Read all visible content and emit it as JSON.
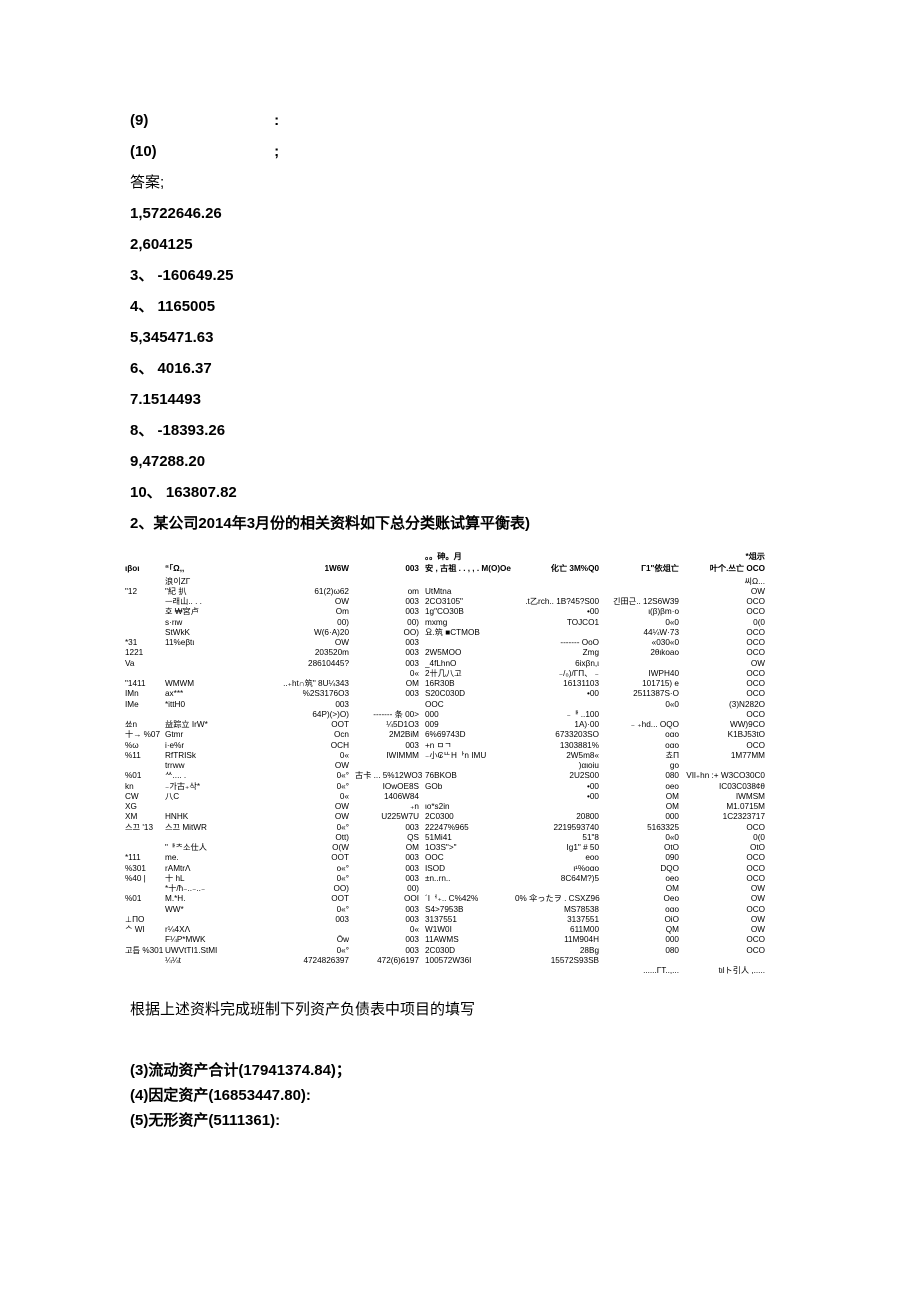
{
  "top": {
    "q9_label": "(9)",
    "q9_end": ":",
    "q10_label": "(10)",
    "q10_end": ";",
    "answers_label": "答案;",
    "answers": [
      "1,5722646.26",
      "2,604125",
      "3、 -160649.25",
      "4、 1165005",
      "5,345471.63",
      "6、  4016.37",
      "7.1514493",
      "8、 -18393.26",
      "9,47288.20",
      "10、 163807.82"
    ],
    "section2": "2、某公司2014年3月份的相关资料如下总分类账试算平衡表)"
  },
  "table_header_left": "。。砷。月",
  "table_header_right": "*俎示",
  "table_cols": {
    "h1": "ιβοι",
    "h2": "“「Ω,,",
    "h3": "1W6W",
    "h4": "003",
    "h5": "安 , 古祖 . . , , .  M(O)Oe",
    "h6": "化亡 3M%Q0",
    "h7": "Γ1\"依俎亡",
    "h8": "叶个.쓰亡 OCO"
  },
  "rows": [
    {
      "c1": "",
      "c2": "浪이ZΓ",
      "c3": "",
      "c4": "",
      "c5": "",
      "c6": "",
      "c7": "",
      "c8": "씨Ω..."
    },
    {
      "c1": "\"12",
      "c2": "\"紀   扒",
      "c3": "61(2)ω62",
      "c4": "om",
      "c5": "UtMtna",
      "c6": "",
      "c7": "",
      "c8": "OW"
    },
    {
      "c1": "",
      "c2": "ᅳ래山.. . .",
      "c3": "OW",
      "c4": "003",
      "c5": "2CO3105\"",
      "c6": ".t乙rch.. 1B?45?S00",
      "c7": "긴田근.. 12S6W39",
      "c8": "OCO"
    },
    {
      "c1": "",
      "c2": "호    ₩宮卢",
      "c3": "Om",
      "c4": "003",
      "c5": "1g\"CO30B",
      "c6": "•00",
      "c7": "ι(β)βm·o",
      "c8": "OCO"
    },
    {
      "c1": "",
      "c2": "s·rιw",
      "c3": "00)",
      "c4": "00)",
      "c5": "mxmg",
      "c6": "TOJCO1",
      "c7": "0«0",
      "c8": "0(0"
    },
    {
      "c1": "",
      "c2": "StWkK",
      "c3": "W(6·A)20",
      "c4": "OO)",
      "c5": "요.筑 ■CTMOB",
      "c6": "",
      "c7": "44¼W·73",
      "c8": "OCO"
    },
    {
      "c1": "*31",
      "c2": "11%eβtι",
      "c3": "OW",
      "c4": "003",
      "c5": "",
      "c6": "------- OoO",
      "c7": "«030«0",
      "c8": "OCO"
    },
    {
      "c1": "1221",
      "c2": "",
      "c3": "203520m",
      "c4": "003",
      "c5": "2W5MOO",
      "c6": "Zmg",
      "c7": "2θιkoao",
      "c8": "OCO"
    },
    {
      "c1": "Va",
      "c2": "",
      "c3": "28610445?",
      "c4": "003",
      "c5": "_4fLhnO",
      "c6": "6ixβn,ι",
      "c7": "",
      "c8": "OW"
    },
    {
      "c1": "",
      "c2": "",
      "c3": "",
      "c4": "0«",
      "c5": "2卄几八고",
      "c6": "₋/₀)/ΓΠ、 ₋",
      "c7": "IWPH40",
      "c8": "OCO"
    },
    {
      "c1": "\"1411",
      "c2": "WMWM",
      "c3": "..₊ht∩筑\" 8U¼343",
      "c4": "OM",
      "c5": "16R30B",
      "c6": "16131103",
      "c7": "101715) e",
      "c8": "OCO"
    },
    {
      "c1": "IMn",
      "c2": "ax***",
      "c3": "%2S3176O3",
      "c4": "003",
      "c5": "S20C030D",
      "c6": "•00",
      "c7": "2511387S·O",
      "c8": "OCO"
    },
    {
      "c1": "IMe",
      "c2": "*ittH0",
      "c3": "003",
      "c4": "",
      "c5": "OOC",
      "c6": "",
      "c7": "0«0",
      "c8": "(3)N282O"
    },
    {
      "c1": "",
      "c2": "",
      "c3": "64P)(>)O)",
      "c4": "------- 条 00>",
      "c5": "000",
      "c6": "₋ᆘ ..100",
      "c7": "",
      "c8": "OCO"
    },
    {
      "c1": "쑈n",
      "c2": "益踪立 IrW*",
      "c3": "OOT",
      "c4": "¼5D1O3",
      "c5": "009",
      "c6": "1A)·00",
      "c7": "₋ ₊hd... OQO",
      "c8": "WW)9CO"
    },
    {
      "c1": "十→ %07",
      "c2": "Gtmr",
      "c3": "Ocn",
      "c4": "2M2BiM",
      "c5": "6%69743D",
      "c6": "6733203SO",
      "c7": "oαo",
      "c8": "K1BJ53tO"
    },
    {
      "c1": "%ω",
      "c2": "i·e%r",
      "c3": "OCH",
      "c4": "003",
      "c5": "+n ㅁㄱ",
      "c6": "1303881%",
      "c7": "oαo",
      "c8": "OCO"
    },
    {
      "c1": "%11",
      "c2": "RfTRISk",
      "c3": "0«",
      "c4": "IWIMMM",
      "c5": "₋小₢ᄔHᅡn IMU",
      "c6": "2W5m8«",
      "c7": "쵸Π",
      "c8": "1M77MM"
    },
    {
      "c1": "",
      "c2": "trrww",
      "c3": "OW",
      "c4": "",
      "c5": "",
      "c6": ")αιoiu",
      "c7": "go",
      "c8": ""
    },
    {
      "c1": "%01",
      "c2": "ᄊ.... .",
      "c3": "0«°",
      "c4": "古卡 ... 5%12WO3",
      "c5": "76BKOB",
      "c6": "2U2S00",
      "c7": "080",
      "c8": "VIl₊hn :+ W3CO30C0"
    },
    {
      "c1": "kn",
      "c2": "₋가古₊삭*",
      "c3": "0«°",
      "c4": "IOwOE8S",
      "c5": "GOb",
      "c6": "•00",
      "c7": "oeo",
      "c8": "IC03C038¢θ"
    },
    {
      "c1": "CW",
      "c2": "八C",
      "c3": "0«",
      "c4": "1406W84",
      "c5": "",
      "c6": "•00",
      "c7": "OM",
      "c8": "IWMSM"
    },
    {
      "c1": "XG",
      "c2": "",
      "c3": "OW",
      "c4": "₊n",
      "c5": "ιo*s2in",
      "c6": "",
      "c7": "OM",
      "c8": "M1.0715M"
    },
    {
      "c1": "XM",
      "c2": "HNHK",
      "c3": "OW",
      "c4": "U225W7U",
      "c5": "2C0300",
      "c6": "20800",
      "c7": "000",
      "c8": "1C2323717"
    },
    {
      "c1": "스끄 '13",
      "c2": "스끄 MitWR",
      "c3": "0«°",
      "c4": "003",
      "c5": "22247%965",
      "c6": "2219593740",
      "c7": "5163325",
      "c8": "OCO"
    },
    {
      "c1": "",
      "c2": "",
      "c3": "Ott)",
      "c4": "QS",
      "c5": "51Mi41",
      "c6": "51\"8",
      "c7": "0«0",
      "c8": "0(0"
    },
    {
      "c1": "",
      "c2": "\"ᆘᄎ소仕人",
      "c3": "O(W",
      "c4": "OM",
      "c5": "1O3S\">\"",
      "c6": "Ig1\" # 50",
      "c7": "OtO",
      "c8": "OtO"
    },
    {
      "c1": "*111",
      "c2": "me.",
      "c3": "OOT",
      "c4": "003",
      "c5": "OOC",
      "c6": "eoo",
      "c7": "090",
      "c8": "OCO"
    },
    {
      "c1": "%301",
      "c2": "rAMtrΛ",
      "c3": "o«°",
      "c4": "003",
      "c5": "ISOD",
      "c6": "ι¹%oαo",
      "c7": "DQO",
      "c8": "OCO"
    },
    {
      "c1": "%40 |",
      "c2": "十   hL",
      "c3": "0«°",
      "c4": "003",
      "c5": "±n..rn..",
      "c6": "8C64M?)5",
      "c7": "oeo",
      "c8": "OCO"
    },
    {
      "c1": "",
      "c2": "*十/ħ₋..₋..₋",
      "c3": "OO)",
      "c4": "00)",
      "c5": "",
      "c6": "",
      "c7": "OM",
      "c8": "OW"
    },
    {
      "c1": "%01",
      "c2": "M.*H.",
      "c3": "OOT",
      "c4": "OOI",
      "c5": "´Iᅥ₊.. C%42%",
      "c6": "0% 伞ったヲ . CSXZ96",
      "c7": "Oeo",
      "c8": "OW"
    },
    {
      "c1": "",
      "c2": "WW*",
      "c3": "0«°",
      "c4": "003",
      "c5": "S4>7953B",
      "c6": "MS78538",
      "c7": "oαo",
      "c8": "OCO"
    },
    {
      "c1": "⊥ΠO",
      "c2": "",
      "c3": "003",
      "c4": "003",
      "c5": "3137551",
      "c6": "3137551",
      "c7": "OiO",
      "c8": "OW"
    },
    {
      "c1": "ᄉ WI",
      "c2": "r¼4XΛ",
      "c3": "",
      "c4": "0«",
      "c5": "W1W0I",
      "c6": "611M00",
      "c7": "QM",
      "c8": "OW"
    },
    {
      "c1": "",
      "c2": "F¼P*MWK",
      "c3": "Ôw",
      "c4": "003",
      "c5": "11AWMS",
      "c6": "11M904H",
      "c7": "000",
      "c8": "OCO"
    },
    {
      "c1": "고틉 %301",
      "c2": "UWVtTI1.StMI",
      "c3": "0«°",
      "c4": "003",
      "c5": "2C030D",
      "c6": "28Bg",
      "c7": "080",
      "c8": "OCO"
    },
    {
      "c1": "",
      "c2": "¼¼t",
      "c3": "4724826397",
      "c4": "472(6)6197",
      "c5": "100572W36I",
      "c6": "15572S93SB",
      "c7": "",
      "c8": ""
    },
    {
      "c1": "",
      "c2": "",
      "c3": "",
      "c4": "",
      "c5": "",
      "c6": "",
      "c7": "......ΓΤ..,...",
      "c8": "tιlト引人  ,....."
    }
  ],
  "post_instruction": "根据上述资料完成班制下列资产负债表中项目的填写",
  "items": [
    "(3)流动资产合计(17941374.84)；",
    "(4)因定资产(16853447.80):",
    "(5)无形资产(5111361):"
  ]
}
